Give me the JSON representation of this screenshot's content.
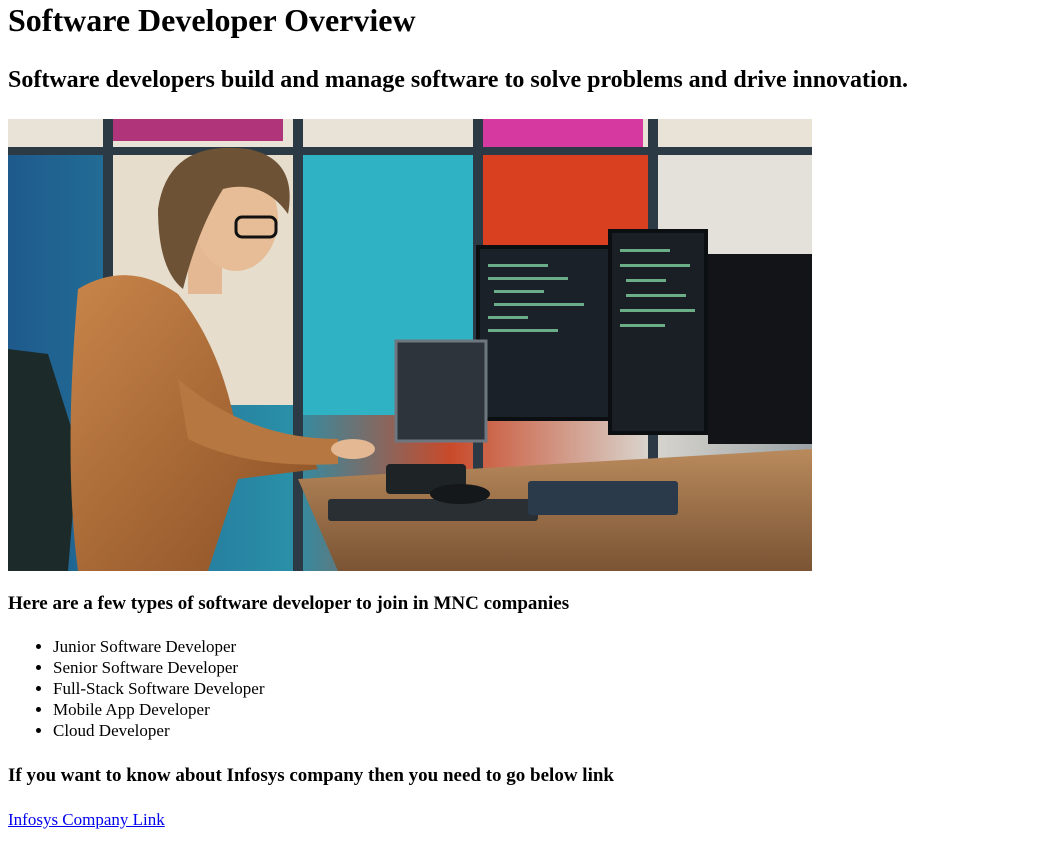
{
  "page": {
    "title": "Software Developer Overview",
    "subtitle": "Software developers build and manage software to solve problems and drive innovation."
  },
  "hero_image": {
    "description_icon": "developer-photo-icon"
  },
  "types_section": {
    "heading": "Here are a few types of software developer to join in MNC companies",
    "items": [
      "Junior Software Developer",
      "Senior Software Developer",
      "Full-Stack Software Developer",
      "Mobile App Developer",
      "Cloud Developer"
    ]
  },
  "link_section": {
    "heading": "If you want to know about Infosys company then you need to go below link",
    "link_text": "Infosys Company Link"
  },
  "colors": {
    "link": "#0000ee",
    "text": "#000000",
    "background": "#ffffff"
  }
}
